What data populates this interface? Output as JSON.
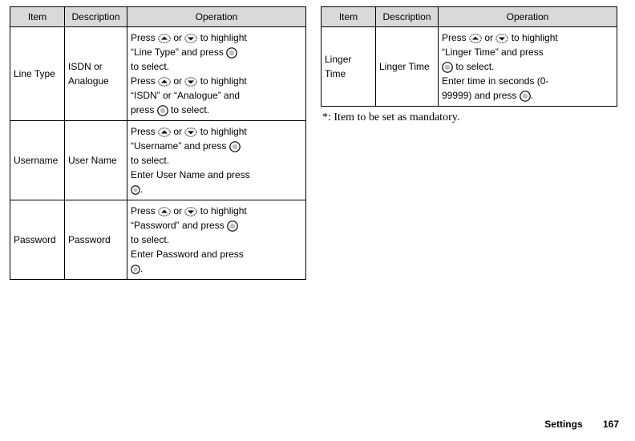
{
  "headers": {
    "item": "Item",
    "description": "Description",
    "operation": "Operation"
  },
  "left": [
    {
      "item": "Line Type",
      "description": "ISDN or Analogue",
      "op": {
        "a1": "Press ",
        "a2": " or ",
        "a3": " to highlight",
        "b1": "“Line Type” and press ",
        "c1": "to select.",
        "d1": "Press ",
        "d2": " or ",
        "d3": " to highlight",
        "e1": "“ISDN” or “Analogue” and",
        "f1": "press ",
        "f2": " to select."
      }
    },
    {
      "item": "Username",
      "description": "User Name",
      "op": {
        "a1": "Press ",
        "a2": " or ",
        "a3": " to highlight",
        "b1": "“Username” and press ",
        "c1": "to select.",
        "d1": "Enter User Name and press",
        "e1": "."
      }
    },
    {
      "item": "Password",
      "description": "Password",
      "op": {
        "a1": "Press ",
        "a2": " or ",
        "a3": " to highlight",
        "b1": "“Password” and press ",
        "c1": "to select.",
        "d1": "Enter Password and press",
        "e1": "."
      }
    }
  ],
  "right": [
    {
      "item": "Linger Time",
      "description": "Linger Time",
      "op": {
        "a1": "Press ",
        "a2": " or ",
        "a3": " to highlight",
        "b1": "“Linger Time” and press",
        "c1": " to select.",
        "d1": "Enter time in seconds (0-",
        "e1": "99999) and press ",
        "e2": "."
      }
    }
  ],
  "note": "*: Item to be set as mandatory.",
  "footer": {
    "section": "Settings",
    "page": "167"
  }
}
